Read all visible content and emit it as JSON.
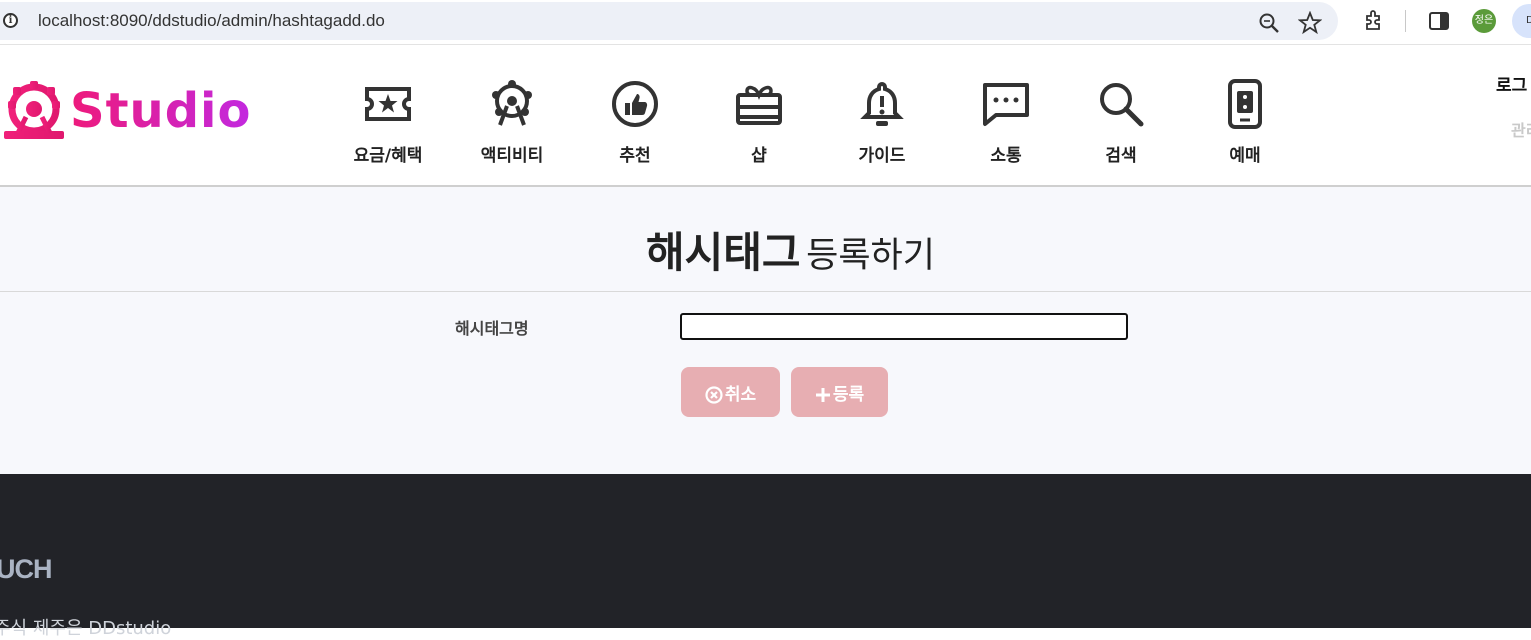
{
  "browser": {
    "url": "localhost:8090/ddstudio/admin/hashtagadd.do",
    "profile_initials": "정은",
    "profile_chip_text": "D"
  },
  "header": {
    "logo_text": "Studio",
    "nav": [
      {
        "label": "요금/혜택",
        "icon": "ticket-icon"
      },
      {
        "label": "액티비티",
        "icon": "ferris-wheel-icon"
      },
      {
        "label": "추천",
        "icon": "thumbs-up-icon"
      },
      {
        "label": "샵",
        "icon": "gift-icon"
      },
      {
        "label": "가이드",
        "icon": "bell-icon"
      },
      {
        "label": "소통",
        "icon": "chat-icon"
      },
      {
        "label": "검색",
        "icon": "search-icon"
      },
      {
        "label": "예매",
        "icon": "mobile-ticket-icon"
      }
    ],
    "user_link_top": "로그",
    "user_link_bottom": "관리"
  },
  "main": {
    "title_bold": "해시태그",
    "title_rest": "등록하기",
    "field_label": "해시태그명",
    "field_value": "",
    "cancel_label": "취소",
    "submit_label": "등록"
  },
  "footer": {
    "brand": "UCH",
    "company": "주식 제주은 DDstudio"
  },
  "colors": {
    "button_bg": "#e7aeb2",
    "footer_bg": "#222328",
    "logo_gradient_start": "#ee1a7b",
    "logo_gradient_end": "#c229e0"
  }
}
